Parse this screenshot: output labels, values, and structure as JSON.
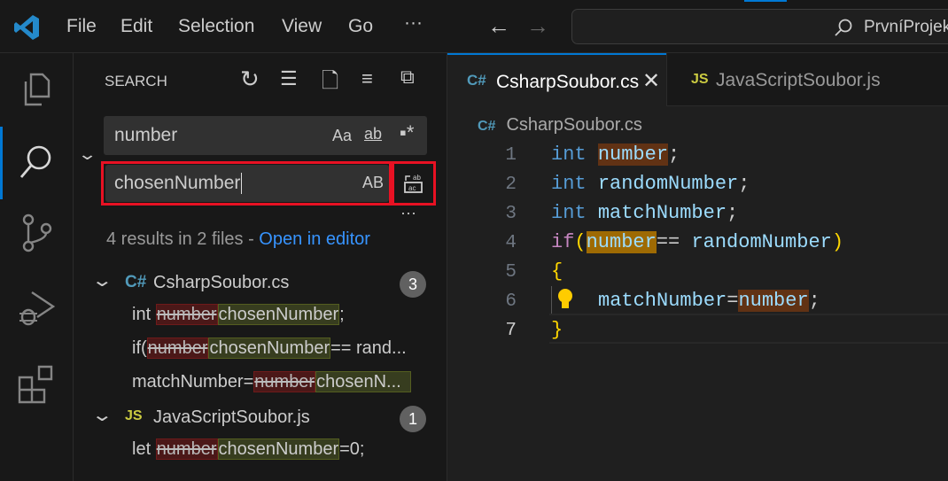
{
  "menu": [
    "File",
    "Edit",
    "Selection",
    "View",
    "Go",
    "···"
  ],
  "command_center": {
    "text": "PrvníProjekt"
  },
  "search": {
    "title": "SEARCH",
    "find_value": "number",
    "find_options": [
      "Aa",
      "ab",
      "*"
    ],
    "replace_value": "chosenNumber",
    "preserve_case": "AB",
    "more": "···",
    "summary": "4 results in 2 files - ",
    "open_in_editor": "Open in editor",
    "files": [
      {
        "icon": "C#",
        "name": "CsharpSoubor.cs",
        "count": "3",
        "matches": [
          {
            "pre": "int ",
            "old": "number",
            "new": "chosenNumber",
            "post": ";"
          },
          {
            "pre": "if(",
            "old": "number",
            "new": "chosenNumber",
            "post": "== rand..."
          },
          {
            "pre": "matchNumber=",
            "old": "number",
            "new": "chosenN...",
            "post": ""
          }
        ]
      },
      {
        "icon": "JS",
        "name": "JavaScriptSoubor.js",
        "count": "1",
        "matches": [
          {
            "pre": "let ",
            "old": "number",
            "new": "chosenNumber",
            "post": "=0;"
          }
        ]
      }
    ]
  },
  "tabs": [
    {
      "label": "CsharpSoubor.cs",
      "icon": "C#",
      "active": true
    },
    {
      "label": "JavaScriptSoubor.js",
      "icon": "JS"
    }
  ],
  "breadcrumb": "CsharpSoubor.cs",
  "code": {
    "lines": [
      "1",
      "2",
      "3",
      "4",
      "5",
      "6",
      "7"
    ],
    "t": {
      "int": "int",
      "number": "number",
      "semi": ";",
      "randomNumber": "randomNumber",
      "matchNumber": "matchNumber",
      "if": "if",
      "lp": "(",
      "rp": ")",
      "eq": "== ",
      "assign": "=",
      "lb": "{",
      "rb": "}"
    }
  },
  "colors": {
    "accent": "#0078d4",
    "highlight_box": "#e81123"
  }
}
